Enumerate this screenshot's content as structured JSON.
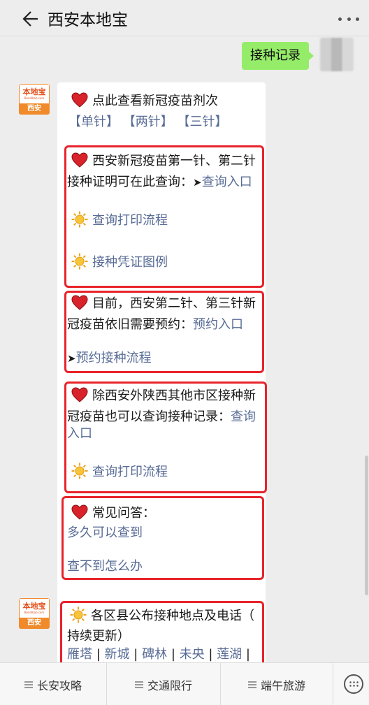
{
  "header": {
    "title": "西安本地宝"
  },
  "user_message": "接种记录",
  "bot_avatar": {
    "brand": "本地宝",
    "url": "Bendibao.com",
    "city": "西安"
  },
  "message1": {
    "intro": "点此查看新冠疫苗剂次",
    "dose_links": [
      "【单针】",
      "【两针】",
      "【三针】"
    ],
    "box1": {
      "line1": "西安新冠疫苗第一针、第二针",
      "line2": "接种证明可在此查询：",
      "pointer": "➤",
      "link": "查询入口",
      "item1": "查询打印流程",
      "item2": "接种凭证图例"
    },
    "box2": {
      "line1": "目前，西安第二针、第三针新",
      "line2": "冠疫苗依旧需要预约：",
      "link": "预约入口",
      "pointer": "➤",
      "link2": "预约接种流程"
    },
    "box3": {
      "line1": "除西安外陕西其他市区接种新",
      "line2": "冠疫苗也可以查询接种记录：",
      "link_a": "查询",
      "link_b": "入口",
      "item1": "查询打印流程"
    },
    "box4": {
      "title": "常见问答：",
      "q1": "多久可以查到",
      "q2": "查不到怎么办"
    }
  },
  "message2": {
    "line1": "各区县公布接种地点及电话（",
    "line2": "持续更新）",
    "districts": [
      "雁塔",
      "新城",
      "碑林",
      "未央",
      "莲湖"
    ],
    "sep": "|"
  },
  "bottom_menu": [
    "长安攻略",
    "交通限行",
    "端午旅游"
  ]
}
